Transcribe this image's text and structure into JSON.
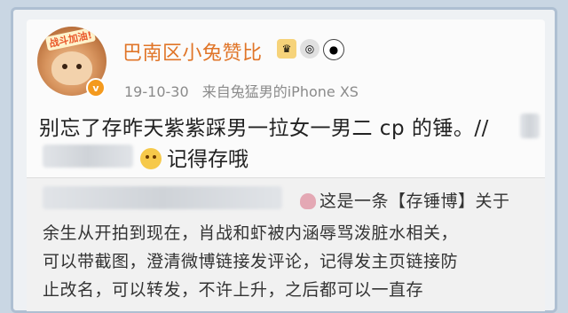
{
  "post": {
    "username": "巴南区小兔赞比",
    "avatar_banner": "战斗加油!",
    "badges": [
      "crown-icon",
      "medal-icon",
      "panda-icon"
    ],
    "date": "19-10-30",
    "source": "来自兔猛男的iPhone XS",
    "text_line1": "别忘了存昨天紫紫踩男一拉女一男二 cp 的锤。//",
    "text_line2": "记得存哦"
  },
  "repost": {
    "line1": "这是一条【存锤博】关于",
    "line2": "余生从开拍到现在，肖战和虾被内涵辱骂泼脏水相关，",
    "line3": "可以带截图，澄清微博链接发评论，记得发主页链接防",
    "line4": "止改名，可以转发，不许上升，之后都可以一直存"
  },
  "colors": {
    "username": "#e07528",
    "verified": "#f49a1e",
    "meta": "#8b8b8b"
  }
}
